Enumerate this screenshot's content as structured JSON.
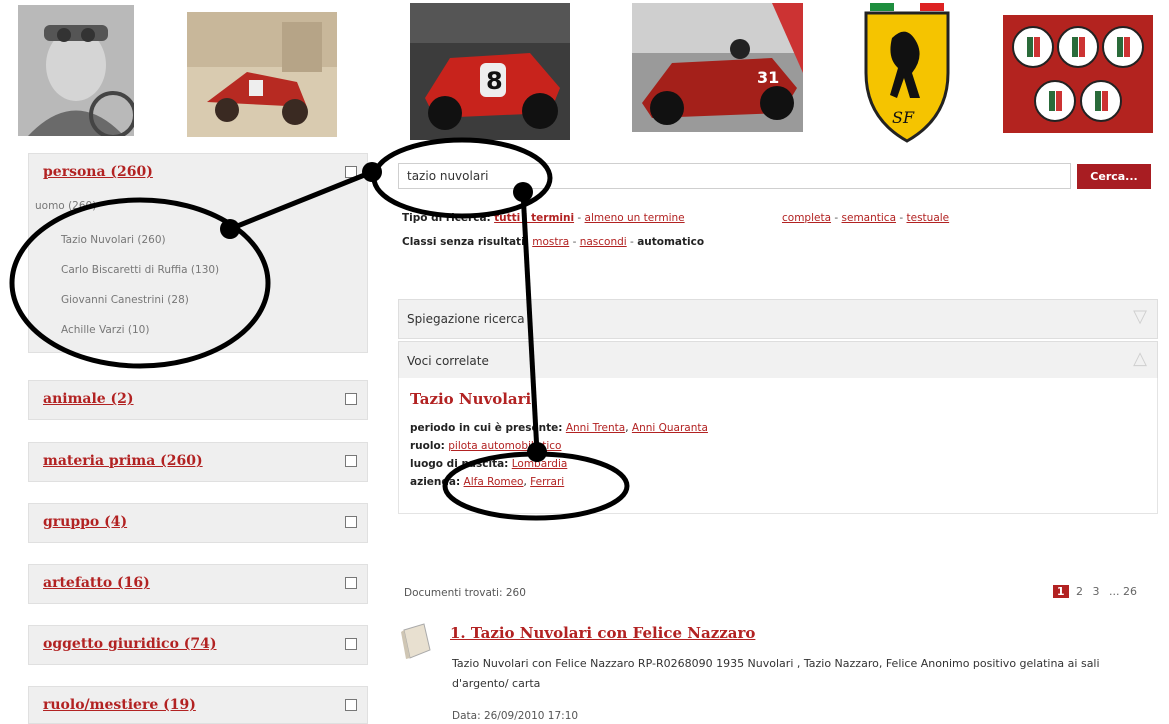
{
  "thumbnails": [
    {
      "name": "portrait-photo",
      "alt": "Tazio Nuvolari portrait"
    },
    {
      "name": "painting-car",
      "alt": "Red race car painting"
    },
    {
      "name": "race-car-8",
      "alt": "Red race car number 8"
    },
    {
      "name": "race-car-31",
      "alt": "Red race car number 31"
    },
    {
      "name": "ferrari-logo",
      "alt": "Ferrari shield logo"
    },
    {
      "name": "alfa-romeo-badges",
      "alt": "Alfa Romeo badges"
    }
  ],
  "facets": [
    {
      "label": "persona (260)",
      "group": "uomo (260)",
      "items": [
        "Tazio Nuvolari (260)",
        "Carlo Biscaretti di Ruffia (130)",
        "Giovanni Canestrini (28)",
        "Achille Varzi (10)"
      ]
    },
    {
      "label": "animale (2)"
    },
    {
      "label": "materia prima (260)"
    },
    {
      "label": "gruppo (4)"
    },
    {
      "label": "artefatto (16)"
    },
    {
      "label": "oggetto giuridico (74)"
    },
    {
      "label": "ruolo/mestiere (19)"
    }
  ],
  "search": {
    "value": "tazio nuvolari",
    "button": "Cerca...",
    "type_label": "Tipo di ricerca:",
    "type_options": [
      "tutti i termini",
      "almeno un termine",
      "completa",
      "semantica",
      "testuale"
    ],
    "empty_label": "Classi senza risultati:",
    "empty_options": [
      "mostra",
      "nascondi",
      "automatico"
    ]
  },
  "panels": {
    "explain": "Spiegazione ricerca",
    "related": "Voci correlate"
  },
  "related": {
    "title": "Tazio Nuvolari",
    "rows": [
      {
        "label": "periodo in cui è presente:",
        "links": [
          "Anni Trenta",
          "Anni Quaranta"
        ]
      },
      {
        "label": "ruolo:",
        "links": [
          "pilota automobilistico"
        ]
      },
      {
        "label": "luogo di nascita:",
        "links": [
          "Lombardia"
        ]
      },
      {
        "label": "azienda:",
        "links": [
          "Alfa Romeo",
          "Ferrari"
        ]
      }
    ]
  },
  "results": {
    "found": "Documenti trovati: 260",
    "pages": [
      "1",
      "2",
      "3",
      "... 26"
    ],
    "items": [
      {
        "title": "1. Tazio Nuvolari con Felice Nazzaro",
        "desc": "Tazio  Nuvolari  con Felice Nazzaro RP-R0268090 1935  Nuvolari ,  Tazio  Nazzaro, Felice Anonimo positivo gelatina ai sali d'argento/ carta",
        "date": "Data: 26/09/2010 17:10"
      }
    ]
  },
  "colors": {
    "accent": "#b22222",
    "button": "#a81d22",
    "panel": "#f1f1f1"
  }
}
